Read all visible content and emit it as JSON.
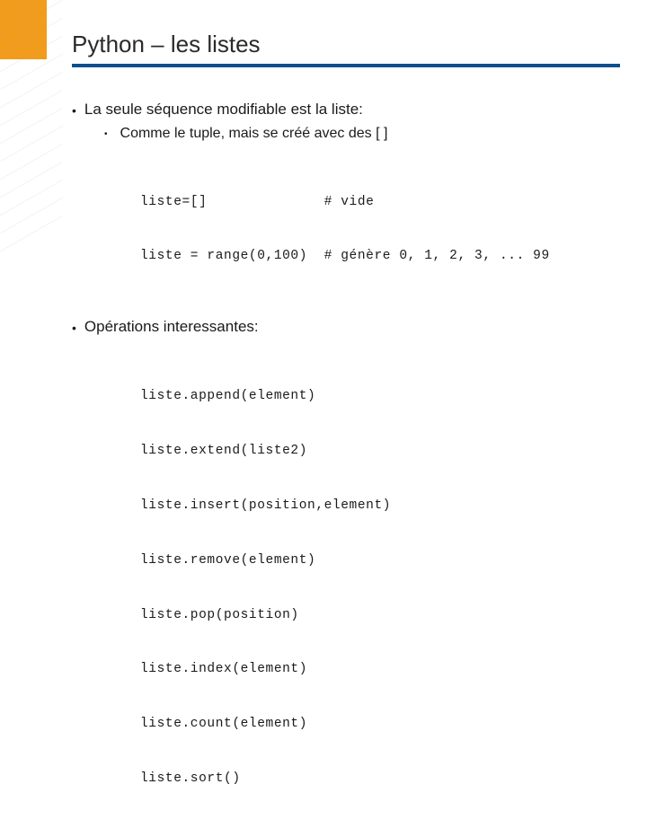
{
  "title": "Python – les listes",
  "bullets": [
    {
      "text": "La seule séquence modifiable est la liste:",
      "sub": [
        {
          "text": "Comme le tuple, mais se créé avec des [ ]"
        }
      ],
      "code": [
        "liste=[]              # vide",
        "liste = range(0,100)  # génère 0, 1, 2, 3, ... 99"
      ]
    },
    {
      "text": "Opérations interessantes:",
      "code": [
        "liste.append(element)",
        "liste.extend(liste2)",
        "liste.insert(position,element)",
        "liste.remove(element)",
        "liste.pop(position)",
        "liste.index(element)",
        "liste.count(element)",
        "liste.sort()"
      ]
    }
  ]
}
